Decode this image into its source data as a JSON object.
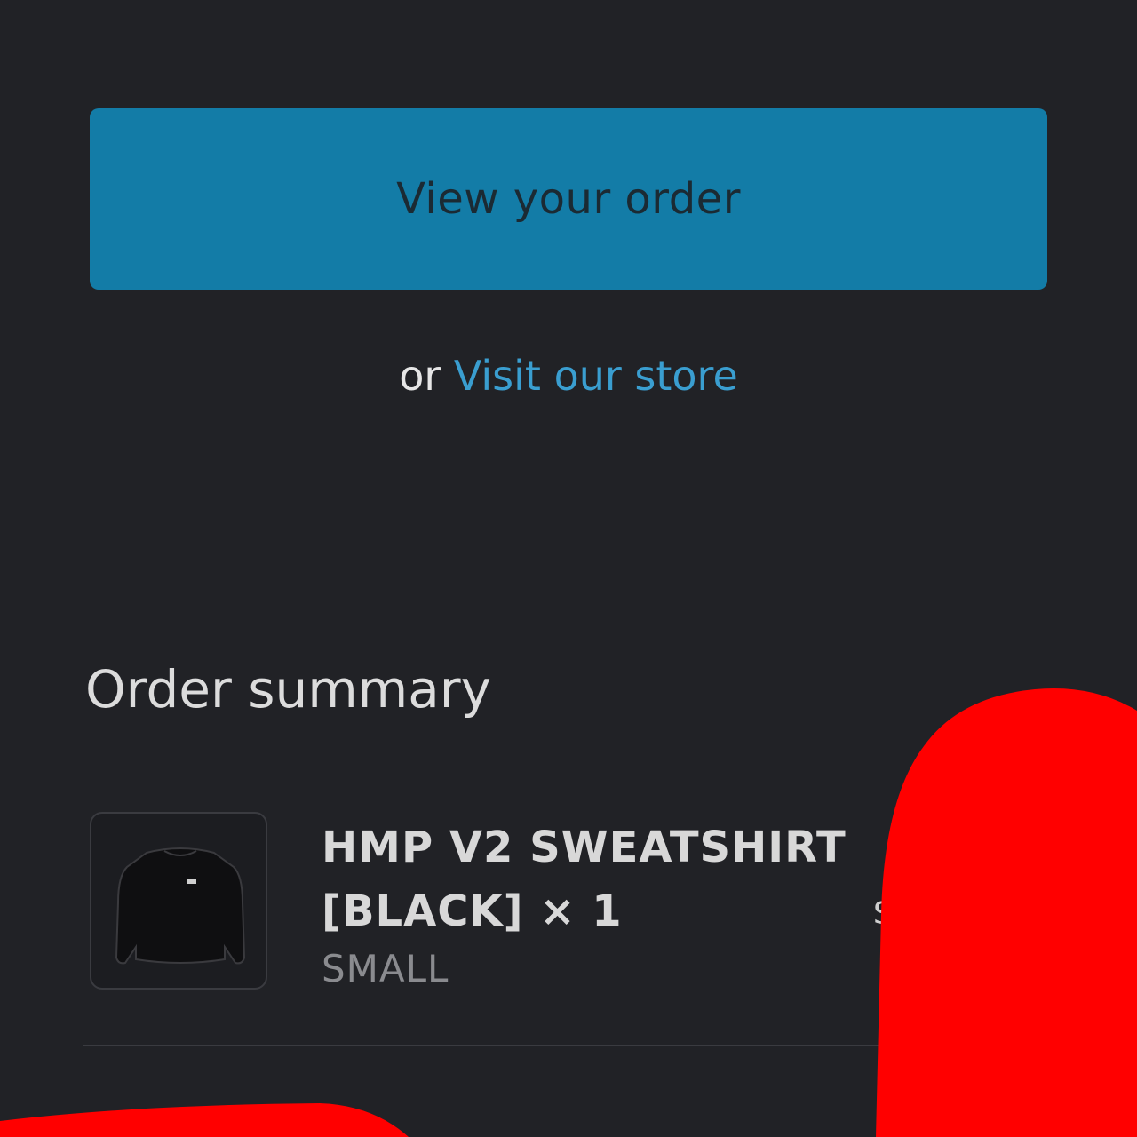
{
  "actions": {
    "view_order_label": "View your order",
    "or_text": "or",
    "visit_store_label": "Visit our store"
  },
  "order_summary": {
    "title": "Order summary",
    "items": [
      {
        "name": "HMP V2 SWEATSHIRT [BLACK] × 1",
        "variant": "SMALL",
        "image_icon": "sweatshirt-icon",
        "price_fragment": "$"
      }
    ]
  },
  "colors": {
    "background": "#212226",
    "button": "#137ca7",
    "link": "#3a9ed0",
    "redaction": "#ff0000"
  }
}
